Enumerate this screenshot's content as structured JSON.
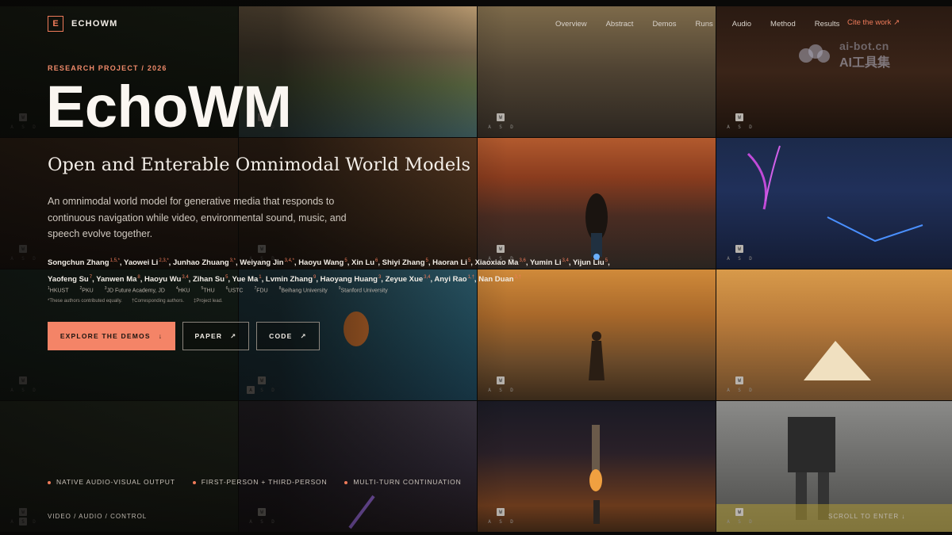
{
  "brand": {
    "mark": "E",
    "name": "ECHOWM"
  },
  "nav": {
    "items": [
      "Overview",
      "Abstract",
      "Demos",
      "Runs",
      "Audio",
      "Method",
      "Results"
    ],
    "cite": "Cite the work ↗"
  },
  "watermark": {
    "line1": "ai-bot.cn",
    "line2": "AI工具集"
  },
  "hero": {
    "eyebrow": "RESEARCH PROJECT / 2026",
    "title": "EchoWM",
    "subtitle": "Open and Enterable Omnimodal World Models",
    "description": "An omnimodal world model for generative media that responds to continuous navigation while video, environmental sound, music, and speech evolve together."
  },
  "authors": [
    {
      "name": "Songchun Zhang",
      "sup": "1,5,*"
    },
    {
      "name": "Yaowei Li",
      "sup": "2,3,*"
    },
    {
      "name": "Junhao Zhuang",
      "sup": "3,*"
    },
    {
      "name": "Weiyang Jin",
      "sup": "3,4,*"
    },
    {
      "name": "Haoyu Wang",
      "sup": "5"
    },
    {
      "name": "Xin Lu",
      "sup": "6"
    },
    {
      "name": "Shiyi Zhang",
      "sup": "5"
    },
    {
      "name": "Haoran Li",
      "sup": "5"
    },
    {
      "name": "Xiaoxiao Ma",
      "sup": "3,6"
    },
    {
      "name": "Yumin Li",
      "sup": "3,4"
    },
    {
      "name": "Yijun Liu",
      "sup": "5"
    },
    {
      "name": "Yaofeng Su",
      "sup": "7"
    },
    {
      "name": "Yanwen Ma",
      "sup": "8"
    },
    {
      "name": "Haoyu Wu",
      "sup": "3,4"
    },
    {
      "name": "Zihan Su",
      "sup": "5"
    },
    {
      "name": "Yue Ma",
      "sup": "1"
    },
    {
      "name": "Lvmin Zhang",
      "sup": "9"
    },
    {
      "name": "Haoyang Huang",
      "sup": "3"
    },
    {
      "name": "Zeyue Xue",
      "sup": "3,4"
    },
    {
      "name": "Anyi Rao",
      "sup": "1,†"
    },
    {
      "name": "Nan Duan",
      "sup": "3,†"
    }
  ],
  "affiliations": [
    {
      "sup": "1",
      "name": "HKUST"
    },
    {
      "sup": "2",
      "name": "PKU"
    },
    {
      "sup": "3",
      "name": "JD Future Academy, JD"
    },
    {
      "sup": "4",
      "name": "HKU"
    },
    {
      "sup": "5",
      "name": "THU"
    },
    {
      "sup": "6",
      "name": "USTC"
    },
    {
      "sup": "7",
      "name": "FDU"
    },
    {
      "sup": "8",
      "name": "Beihang University"
    },
    {
      "sup": "9",
      "name": "Stanford University"
    }
  ],
  "notes": [
    "*These authors contributed equally.",
    "†Corresponding authors.",
    "‡Project lead."
  ],
  "buttons": {
    "explore": "EXPLORE THE DEMOS",
    "explore_arrow": "↓",
    "paper": "PAPER",
    "paper_arrow": "↗",
    "code": "CODE",
    "code_arrow": "↗"
  },
  "features": [
    "NATIVE AUDIO-VISUAL OUTPUT",
    "FIRST-PERSON + THIRD-PERSON",
    "MULTI-TURN CONTINUATION"
  ],
  "footer": {
    "left": "VIDEO / AUDIO / CONTROL",
    "right": "SCROLL TO ENTER ↓"
  },
  "keys": {
    "w": "W",
    "a": "A",
    "s": "S",
    "d": "D"
  },
  "colors": {
    "accent": "#ef7b5a",
    "button": "#f48467",
    "background": "#0a0908"
  }
}
